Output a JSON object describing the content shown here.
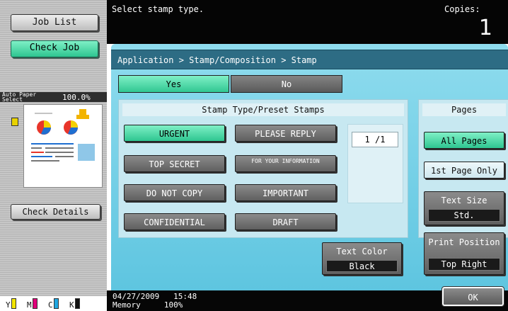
{
  "left": {
    "job_list": "Job List",
    "check_job": "Check Job",
    "paper_mode": "Auto Paper Select",
    "zoom": "100.0%",
    "check_details": "Check Details",
    "toner": [
      {
        "label": "Y",
        "color": "#f2e500"
      },
      {
        "label": "M",
        "color": "#e0007a"
      },
      {
        "label": "C",
        "color": "#1fa6e0"
      },
      {
        "label": "K",
        "color": "#111111"
      }
    ]
  },
  "top": {
    "message": "Select stamp type.",
    "copies_label": "Copies:",
    "copies_value": "1"
  },
  "breadcrumb": "Application > Stamp/Composition > Stamp",
  "toggle": {
    "yes": "Yes",
    "no": "No"
  },
  "stamp": {
    "title": "Stamp Type/Preset Stamps",
    "items": [
      {
        "label": "URGENT",
        "selected": true
      },
      {
        "label": "PLEASE REPLY",
        "selected": false
      },
      {
        "label": "TOP SECRET",
        "selected": false
      },
      {
        "label": "FOR YOUR INFORMATION",
        "selected": false
      },
      {
        "label": "DO NOT COPY",
        "selected": false
      },
      {
        "label": "IMPORTANT",
        "selected": false
      },
      {
        "label": "CONFIDENTIAL",
        "selected": false
      },
      {
        "label": "DRAFT",
        "selected": false
      }
    ],
    "page_counter": "1 /1"
  },
  "text_color": {
    "label": "Text Color",
    "value": "Black"
  },
  "pages": {
    "title": "Pages",
    "all_pages": "All Pages",
    "first_page_only": "1st Page Only"
  },
  "text_size": {
    "label": "Text Size",
    "value": "Std."
  },
  "print_position": {
    "label": "Print Position",
    "value": "Top Right"
  },
  "status": {
    "date": "04/27/2009",
    "time": "15:48",
    "memory_label": "Memory",
    "memory_value": "100%"
  },
  "ok": "OK",
  "colors": {
    "accent_green": "#2ec590",
    "panel_blue": "#5ec5e0",
    "bar_teal": "#2d6c84"
  }
}
